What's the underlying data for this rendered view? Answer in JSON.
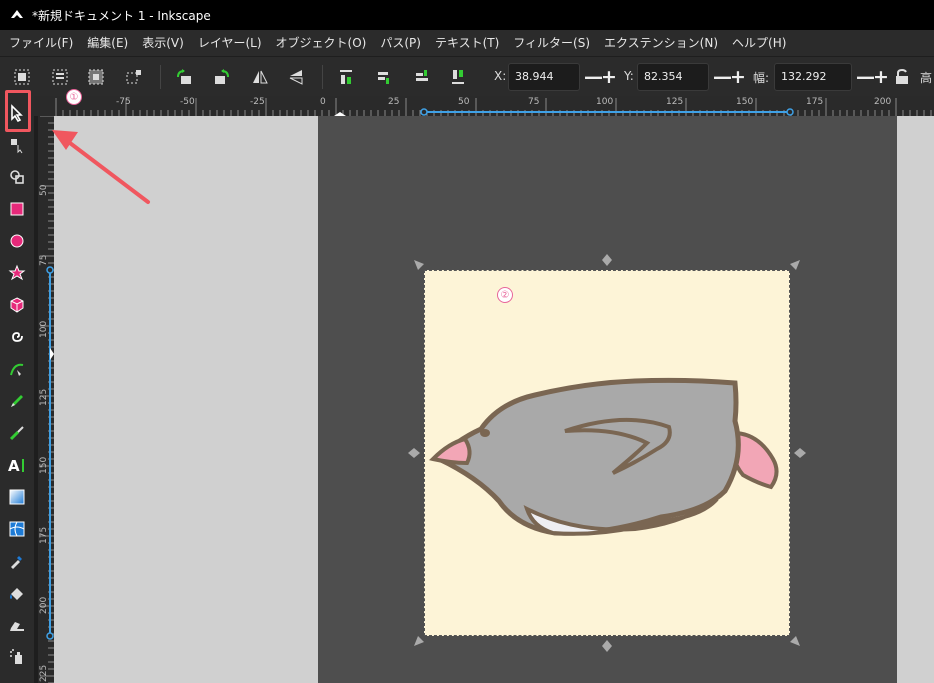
{
  "window": {
    "title": "*新規ドキュメント 1 - Inkscape"
  },
  "menu": {
    "items": [
      "ファイル(F)",
      "編集(E)",
      "表示(V)",
      "レイヤー(L)",
      "オブジェクト(O)",
      "パス(P)",
      "テキスト(T)",
      "フィルター(S)",
      "エクステンション(N)",
      "ヘルプ(H)"
    ]
  },
  "toolbar": {
    "x_label": "X:",
    "x_value": "38.944",
    "y_label": "Y:",
    "y_value": "82.354",
    "w_label": "幅:",
    "w_value": "132.292",
    "h_label": "高",
    "minus": "—",
    "plus": "+"
  },
  "ruler_top": {
    "labels": [
      "-75",
      "-50",
      "-25",
      "0",
      "25",
      "50",
      "75",
      "100",
      "125",
      "150",
      "175",
      "200"
    ]
  },
  "ruler_left": {
    "labels": [
      "50",
      "75",
      "100",
      "125",
      "150",
      "175",
      "200",
      "225"
    ]
  },
  "annotations": {
    "badge_1": "①",
    "badge_2": "②"
  },
  "colors": {
    "accent_highlight": "#f0575f",
    "page_background": "#4e4e4e",
    "canvas_background": "#d0d0d0",
    "image_background": "#fdf4d7",
    "penguin_body": "#a9a9a9",
    "penguin_outline": "#7a6652",
    "penguin_beak": "#f2a6b6"
  },
  "tools": [
    "selector-icon",
    "node-icon",
    "tweak-icon",
    "rectangle-icon",
    "ellipse-icon",
    "star-icon",
    "box3d-icon",
    "spiral-icon",
    "bezier-icon",
    "pencil-icon",
    "calligraphy-icon",
    "text-icon",
    "gradient-icon",
    "mesh-icon",
    "dropper-icon",
    "paint-bucket-icon",
    "eraser-icon",
    "spray-icon"
  ]
}
